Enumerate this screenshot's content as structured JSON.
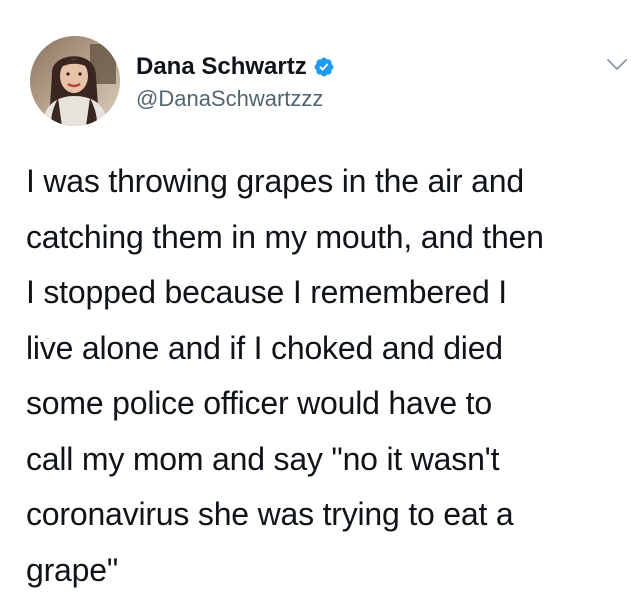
{
  "author": {
    "display_name": "Dana Schwartz",
    "handle": "@DanaSchwartzzz",
    "verified": true,
    "avatar_icon": "profile-photo",
    "verified_icon": "verified-badge-icon",
    "verified_color": "#1d9bf0"
  },
  "menu": {
    "icon": "chevron-down-icon"
  },
  "tweet": {
    "text": "I was throwing grapes in the air and\ncatching them in my mouth, and then\nI stopped because I remembered I\nlive alone and if I choked and died\nsome police officer would have to\ncall my mom and say \"no it wasn't\ncoronavirus she was trying to eat a\ngrape\""
  },
  "colors": {
    "text": "#0f1419",
    "secondary_text": "#536471",
    "background": "#ffffff"
  }
}
